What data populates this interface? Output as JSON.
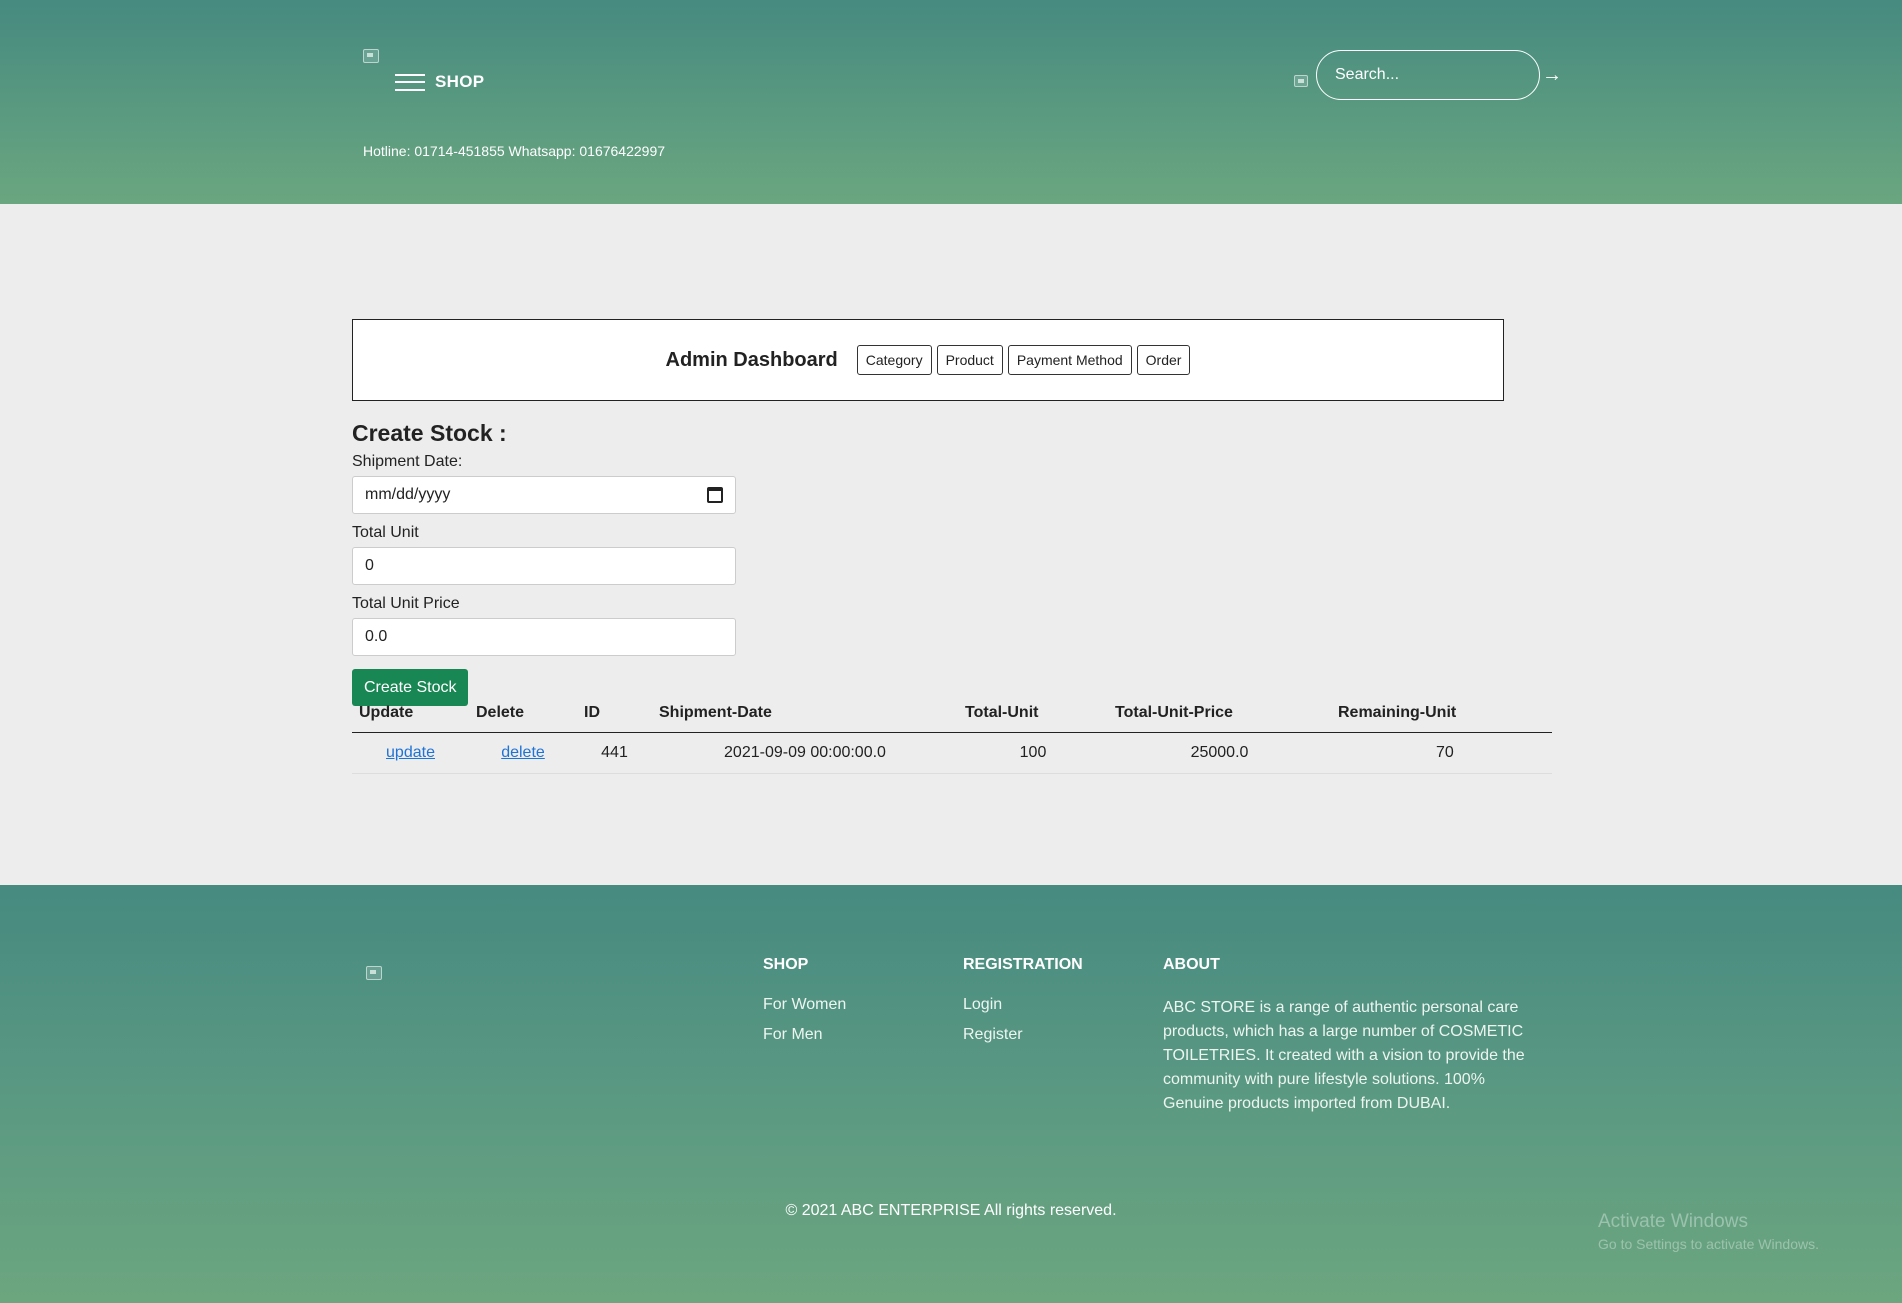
{
  "header": {
    "shop_label": "SHOP",
    "hotline": "Hotline: 01714-451855 Whatsapp: 01676422997",
    "search_placeholder": "Search...",
    "search_arrow": "→"
  },
  "dashboard": {
    "title": "Admin Dashboard",
    "buttons": [
      "Category",
      "Product",
      "Payment Method",
      "Order"
    ]
  },
  "form": {
    "title": "Create Stock :",
    "shipment_date_label": "Shipment Date:",
    "shipment_date_value": "mm/dd/yyyy",
    "total_unit_label": "Total Unit",
    "total_unit_value": "0",
    "total_unit_price_label": "Total Unit Price",
    "total_unit_price_value": "0.0",
    "submit_label": "Create Stock"
  },
  "table": {
    "headers": [
      "Update",
      "Delete",
      "ID",
      "Shipment-Date",
      "Total-Unit",
      "Total-Unit-Price",
      "Remaining-Unit"
    ],
    "rows": [
      {
        "update": "update",
        "delete": "delete",
        "id": "441",
        "shipment_date": "2021-09-09 00:00:00.0",
        "total_unit": "100",
        "total_unit_price": "25000.0",
        "remaining_unit": "70"
      }
    ]
  },
  "footer": {
    "shop_heading": "SHOP",
    "shop_links": [
      "For Women",
      "For Men"
    ],
    "registration_heading": "REGISTRATION",
    "registration_links": [
      "Login",
      "Register"
    ],
    "about_heading": "ABOUT",
    "about_text": "ABC STORE is a range of authentic personal care products, which has a large number of COSMETIC TOILETRIES. It created with a vision to provide the community with pure lifestyle solutions. 100% Genuine products imported from DUBAI.",
    "copyright": "© 2021 ABC ENTERPRISE All rights reserved."
  },
  "watermark": {
    "line1": "Activate Windows",
    "line2": "Go to Settings to activate Windows."
  },
  "colors": {
    "header_top": "#468a80",
    "header_bottom": "#6aa67f",
    "primary_button": "#198754",
    "link": "#1e73d6"
  }
}
